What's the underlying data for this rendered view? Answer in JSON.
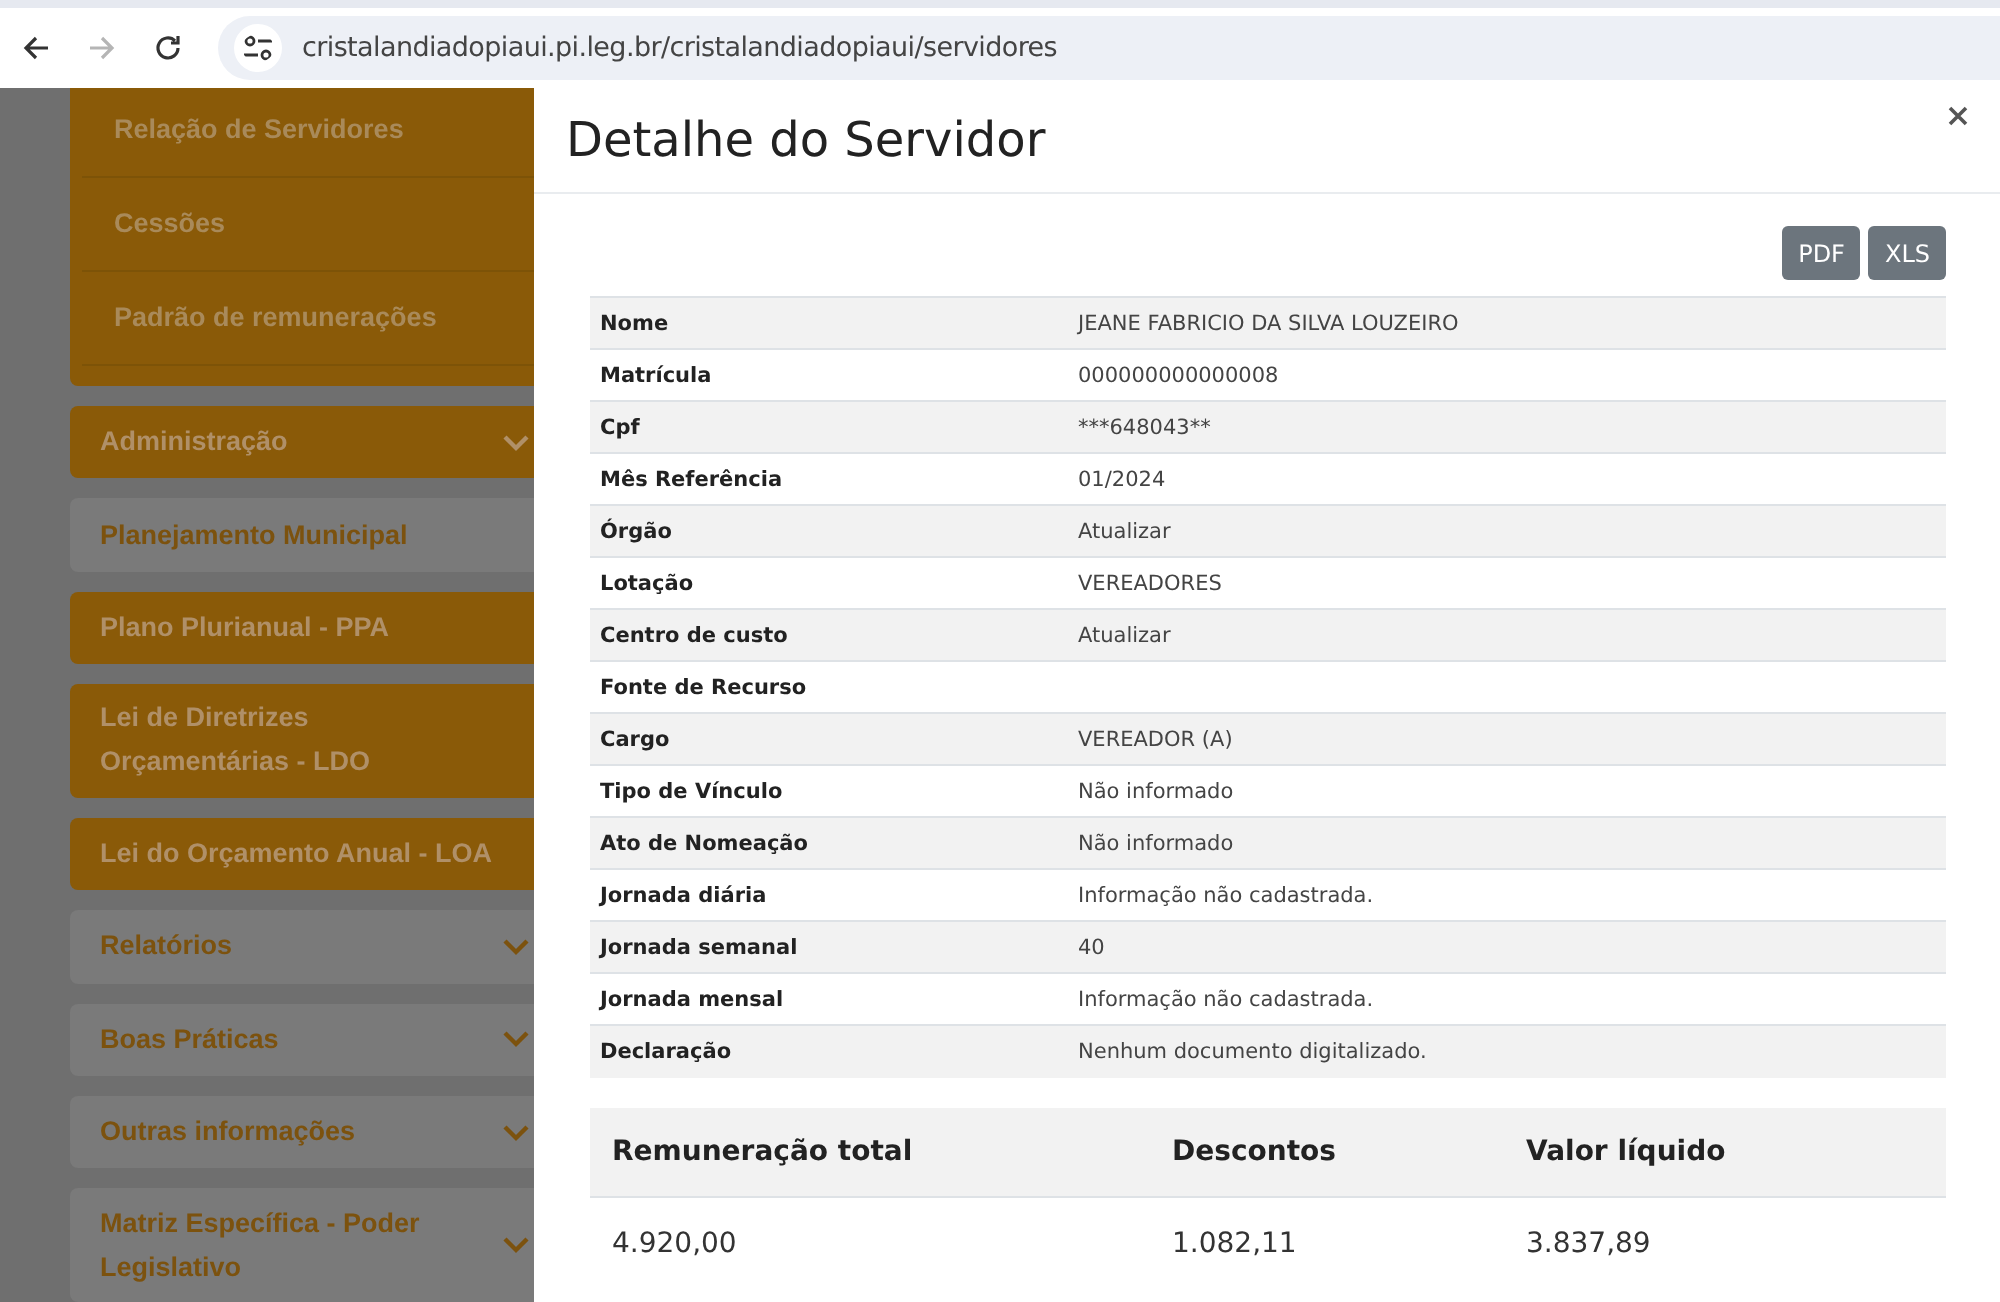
{
  "browser": {
    "url": "cristalandiadopiaui.pi.leg.br/cristalandiadopiaui/servidores",
    "back_disabled": false,
    "forward_disabled": true
  },
  "sidebar": {
    "submenu": [
      "Relação de Servidores",
      "Cessões",
      "Padrão de remunerações"
    ],
    "items": [
      {
        "label": "Administração",
        "kind": "filled",
        "expandable": true
      },
      {
        "label": "Planejamento Municipal",
        "kind": "light",
        "expandable": false
      },
      {
        "label": "Plano Plurianual - PPA",
        "kind": "filled",
        "expandable": false
      },
      {
        "label": "Lei de Diretrizes Orçamentárias - LDO",
        "kind": "filled",
        "expandable": false
      },
      {
        "label": "Lei do Orçamento Anual - LOA",
        "kind": "filled",
        "expandable": false
      },
      {
        "label": "Relatórios",
        "kind": "light",
        "expandable": true
      },
      {
        "label": "Boas Práticas",
        "kind": "light",
        "expandable": true
      },
      {
        "label": "Outras informações",
        "kind": "light",
        "expandable": true
      },
      {
        "label": "Matriz Específica - Poder Legislativo",
        "kind": "light",
        "expandable": true
      }
    ]
  },
  "modal": {
    "title": "Detalhe do Servidor",
    "export_buttons": [
      "PDF",
      "XLS"
    ],
    "details": [
      {
        "label": "Nome",
        "value": "JEANE FABRICIO DA SILVA LOUZEIRO"
      },
      {
        "label": "Matrícula",
        "value": "000000000000008"
      },
      {
        "label": "Cpf",
        "value": "***648043**"
      },
      {
        "label": "Mês Referência",
        "value": "01/2024"
      },
      {
        "label": "Órgão",
        "value": "Atualizar"
      },
      {
        "label": "Lotação",
        "value": "VEREADORES"
      },
      {
        "label": "Centro de custo",
        "value": "Atualizar"
      },
      {
        "label": "Fonte de Recurso"
      },
      {
        "label": "Cargo",
        "value": "VEREADOR (A)"
      },
      {
        "label": "Tipo de Vínculo",
        "value": "Não informado"
      },
      {
        "label": "Ato de Nomeação",
        "value": "Não informado"
      },
      {
        "label": "Jornada diária",
        "value": "Informação não cadastrada."
      },
      {
        "label": "Jornada semanal",
        "value": "40"
      },
      {
        "label": "Jornada mensal",
        "value": "Informação não cadastrada."
      },
      {
        "label": "Declaração",
        "value": "Nenhum documento digitalizado."
      }
    ],
    "summary": {
      "columns": [
        "Remuneração total",
        "Descontos",
        "Valor líquido"
      ],
      "values": [
        "4.920,00",
        "1.082,11",
        "3.837,89"
      ]
    }
  }
}
